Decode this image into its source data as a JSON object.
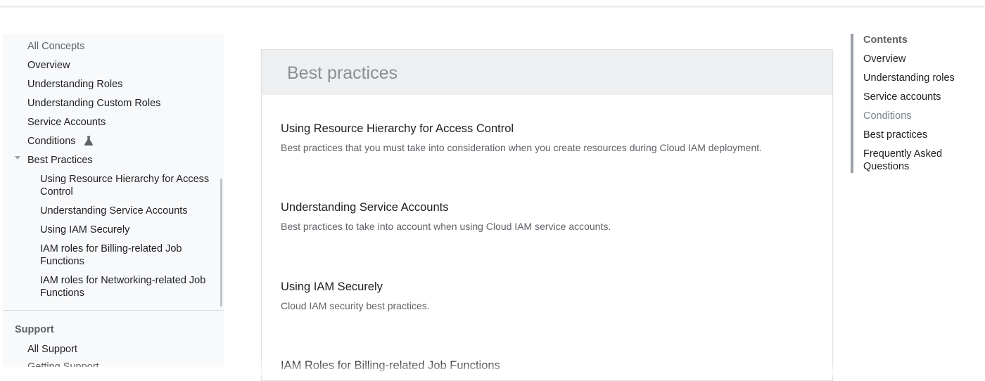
{
  "sidebar": {
    "all_concepts": "All Concepts",
    "items": [
      {
        "label": "Overview"
      },
      {
        "label": "Understanding Roles"
      },
      {
        "label": "Understanding Custom Roles"
      },
      {
        "label": "Service Accounts"
      },
      {
        "label": "Conditions",
        "icon": "flask-icon"
      },
      {
        "label": "Best Practices",
        "expanded": true
      }
    ],
    "subitems": [
      {
        "label": "Using Resource Hierarchy for Access Control"
      },
      {
        "label": "Understanding Service Accounts"
      },
      {
        "label": "Using IAM Securely"
      },
      {
        "label": "IAM roles for Billing-related Job Functions"
      },
      {
        "label": "IAM roles for Networking-related Job Functions"
      }
    ],
    "support_heading": "Support",
    "support_items": [
      {
        "label": "All Support"
      },
      {
        "label": "Getting Support"
      }
    ]
  },
  "main": {
    "title": "Best practices",
    "items": [
      {
        "title": "Using Resource Hierarchy for Access Control",
        "desc": "Best practices that you must take into consideration when you create resources during Cloud IAM deployment."
      },
      {
        "title": "Understanding Service Accounts",
        "desc": "Best practices to take into account when using Cloud IAM service accounts."
      },
      {
        "title": "Using IAM Securely",
        "desc": "Cloud IAM security best practices."
      },
      {
        "title": "IAM Roles for Billing-related Job Functions",
        "desc": ""
      }
    ]
  },
  "toc": {
    "heading": "Contents",
    "items": [
      {
        "label": "Overview"
      },
      {
        "label": "Understanding roles"
      },
      {
        "label": "Service accounts"
      },
      {
        "label": "Conditions",
        "active": true
      },
      {
        "label": "Best practices"
      },
      {
        "label": "Frequently Asked Questions"
      }
    ]
  },
  "colors": {
    "sidebar_bg": "#f8f9fa",
    "card_header_bg": "#eeeff0",
    "toc_bar": "#9aa0a6",
    "muted_text": "#5f6368"
  }
}
